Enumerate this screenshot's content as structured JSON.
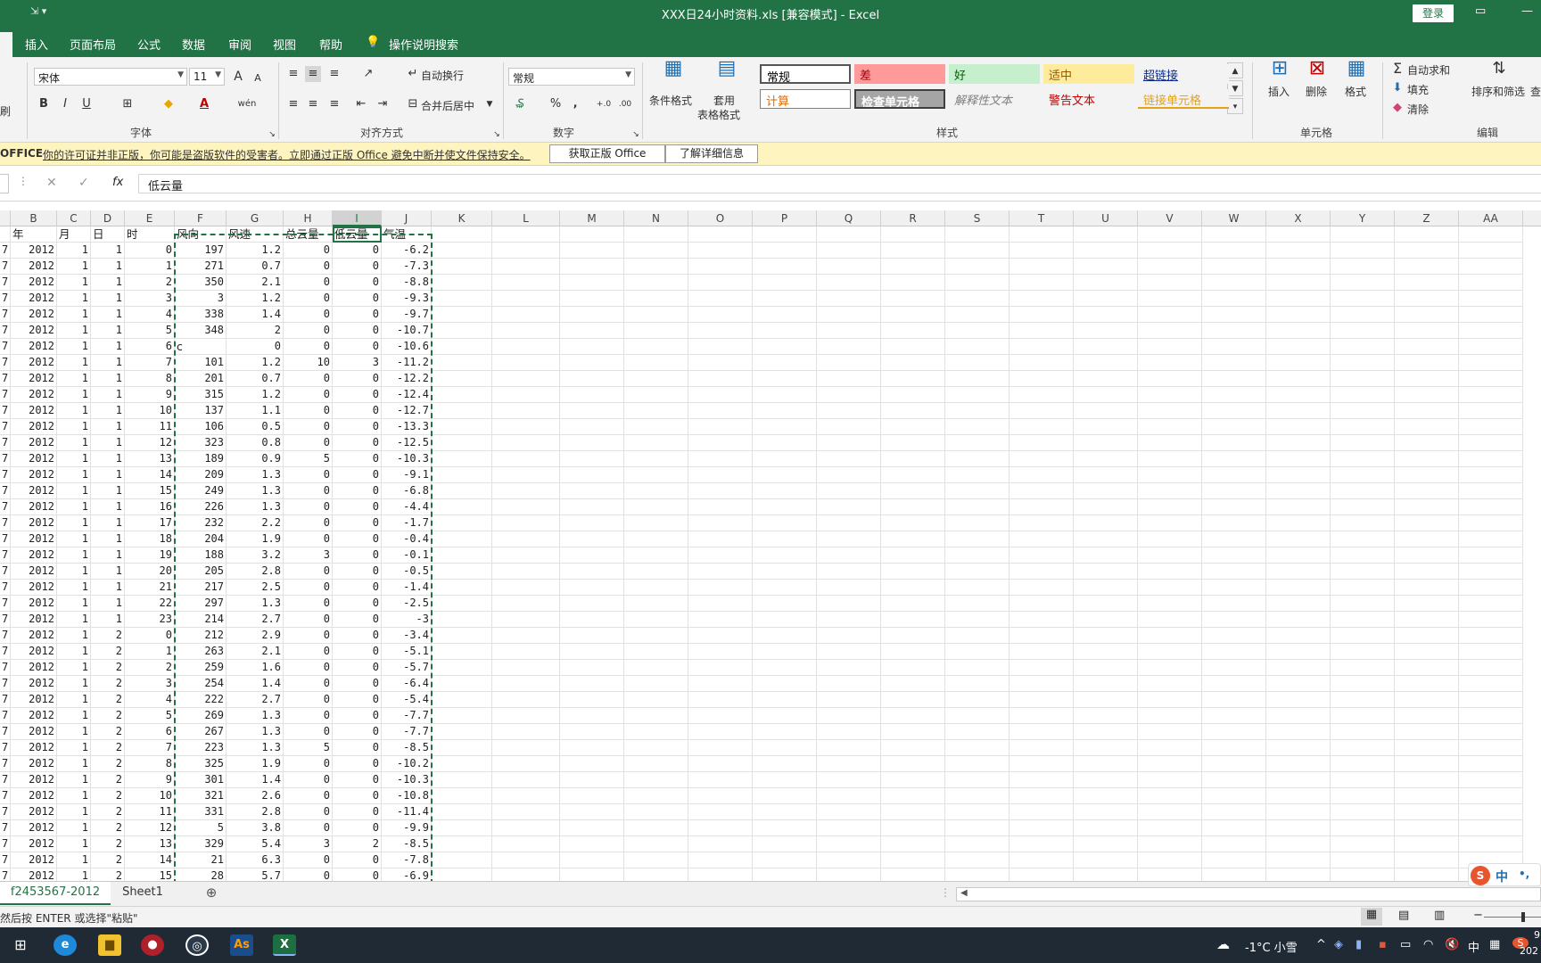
{
  "window": {
    "title": "XXX日24小时资料.xls  [兼容模式]  -  Excel",
    "login": "登录",
    "quick_access": "⇲  ▾"
  },
  "tabs": [
    "插入",
    "页面布局",
    "公式",
    "数据",
    "审阅",
    "视图",
    "帮助",
    "操作说明搜索"
  ],
  "ribbon": {
    "paste_fragment": "刷",
    "font": {
      "name": "宋体",
      "size": "11",
      "group": "字体",
      "grow": "A",
      "shrink": "A",
      "bold": "B",
      "italic": "I",
      "underline": "U",
      "wen": "wén"
    },
    "align": {
      "wrap": "自动换行",
      "merge": "合并后居中",
      "group": "对齐方式"
    },
    "number": {
      "format": "常规",
      "group": "数字",
      "percent": "%",
      "comma": "‚",
      "inc": "←.0\n.00",
      "dec": ".00\n→.0"
    },
    "styles": {
      "cond_format": "条件格式",
      "table_format_1": "套用",
      "table_format_2": "表格格式",
      "group": "样式",
      "items": [
        {
          "label": "常规",
          "bg": "#ffffff",
          "color": "#000000"
        },
        {
          "label": "差",
          "bg": "#ff9a9a",
          "color": "#9c0006"
        },
        {
          "label": "好",
          "bg": "#c6efce",
          "color": "#006100"
        },
        {
          "label": "适中",
          "bg": "#ffeb9c",
          "color": "#9c5700"
        },
        {
          "label": "超链接",
          "bg": "#f3f3f3",
          "color": "#0b2b8f"
        },
        {
          "label": "计算",
          "bg": "#ffffff",
          "color": "#e36c09"
        },
        {
          "label": "检查单元格",
          "bg": "#a5a5a5",
          "color": "#ffffff"
        },
        {
          "label": "解释性文本",
          "bg": "#f3f3f3",
          "color": "#7f7f7f"
        },
        {
          "label": "警告文本",
          "bg": "#f3f3f3",
          "color": "#c00000"
        },
        {
          "label": "链接单元格",
          "bg": "#f3f3f3",
          "color": "#e3a21a"
        }
      ]
    },
    "cells": {
      "insert": "插入",
      "delete": "删除",
      "format": "格式",
      "group": "单元格"
    },
    "edit": {
      "autosum": "自动求和",
      "fill": "填充",
      "clear": "清除",
      "sort": "排序和筛选",
      "find": "查",
      "group": "编辑"
    }
  },
  "message_bar": {
    "label": "OFFICE",
    "text": "你的许可证并非正版，你可能是盗版软件的受害者。立即通过正版 Office 避免中断并使文件保持安全。",
    "btn_get": "获取正版 Office",
    "btn_learn": "了解详细信息"
  },
  "formula_bar": {
    "content": "低云量",
    "fx": "fx",
    "cancel": "✕",
    "enter": "✓"
  },
  "columns": [
    "B",
    "C",
    "D",
    "E",
    "F",
    "G",
    "H",
    "I",
    "J",
    "K",
    "L",
    "M",
    "N",
    "O",
    "P",
    "Q",
    "R",
    "S",
    "T",
    "U",
    "V",
    "W",
    "X",
    "Y",
    "Z",
    "AA"
  ],
  "header_row": [
    "年",
    "月",
    "日",
    "时",
    "风向",
    "风速",
    "总云量",
    "低云量",
    "气温"
  ],
  "rows": [
    [
      "7",
      "2012",
      "1",
      "1",
      "0",
      "197",
      "1.2",
      "0",
      "0",
      "-6.2"
    ],
    [
      "7",
      "2012",
      "1",
      "1",
      "1",
      "271",
      "0.7",
      "0",
      "0",
      "-7.3"
    ],
    [
      "7",
      "2012",
      "1",
      "1",
      "2",
      "350",
      "2.1",
      "0",
      "0",
      "-8.8"
    ],
    [
      "7",
      "2012",
      "1",
      "1",
      "3",
      "3",
      "1.2",
      "0",
      "0",
      "-9.3"
    ],
    [
      "7",
      "2012",
      "1",
      "1",
      "4",
      "338",
      "1.4",
      "0",
      "0",
      "-9.7"
    ],
    [
      "7",
      "2012",
      "1",
      "1",
      "5",
      "348",
      "2",
      "0",
      "0",
      "-10.7"
    ],
    [
      "7",
      "2012",
      "1",
      "1",
      "6",
      "c",
      "0",
      "0",
      "0",
      "-10.6"
    ],
    [
      "7",
      "2012",
      "1",
      "1",
      "7",
      "101",
      "1.2",
      "10",
      "3",
      "-11.2"
    ],
    [
      "7",
      "2012",
      "1",
      "1",
      "8",
      "201",
      "0.7",
      "0",
      "0",
      "-12.2"
    ],
    [
      "7",
      "2012",
      "1",
      "1",
      "9",
      "315",
      "1.2",
      "0",
      "0",
      "-12.4"
    ],
    [
      "7",
      "2012",
      "1",
      "1",
      "10",
      "137",
      "1.1",
      "0",
      "0",
      "-12.7"
    ],
    [
      "7",
      "2012",
      "1",
      "1",
      "11",
      "106",
      "0.5",
      "0",
      "0",
      "-13.3"
    ],
    [
      "7",
      "2012",
      "1",
      "1",
      "12",
      "323",
      "0.8",
      "0",
      "0",
      "-12.5"
    ],
    [
      "7",
      "2012",
      "1",
      "1",
      "13",
      "189",
      "0.9",
      "5",
      "0",
      "-10.3"
    ],
    [
      "7",
      "2012",
      "1",
      "1",
      "14",
      "209",
      "1.3",
      "0",
      "0",
      "-9.1"
    ],
    [
      "7",
      "2012",
      "1",
      "1",
      "15",
      "249",
      "1.3",
      "0",
      "0",
      "-6.8"
    ],
    [
      "7",
      "2012",
      "1",
      "1",
      "16",
      "226",
      "1.3",
      "0",
      "0",
      "-4.4"
    ],
    [
      "7",
      "2012",
      "1",
      "1",
      "17",
      "232",
      "2.2",
      "0",
      "0",
      "-1.7"
    ],
    [
      "7",
      "2012",
      "1",
      "1",
      "18",
      "204",
      "1.9",
      "0",
      "0",
      "-0.4"
    ],
    [
      "7",
      "2012",
      "1",
      "1",
      "19",
      "188",
      "3.2",
      "3",
      "0",
      "-0.1"
    ],
    [
      "7",
      "2012",
      "1",
      "1",
      "20",
      "205",
      "2.8",
      "0",
      "0",
      "-0.5"
    ],
    [
      "7",
      "2012",
      "1",
      "1",
      "21",
      "217",
      "2.5",
      "0",
      "0",
      "-1.4"
    ],
    [
      "7",
      "2012",
      "1",
      "1",
      "22",
      "297",
      "1.3",
      "0",
      "0",
      "-2.5"
    ],
    [
      "7",
      "2012",
      "1",
      "1",
      "23",
      "214",
      "2.7",
      "0",
      "0",
      "-3"
    ],
    [
      "7",
      "2012",
      "1",
      "2",
      "0",
      "212",
      "2.9",
      "0",
      "0",
      "-3.4"
    ],
    [
      "7",
      "2012",
      "1",
      "2",
      "1",
      "263",
      "2.1",
      "0",
      "0",
      "-5.1"
    ],
    [
      "7",
      "2012",
      "1",
      "2",
      "2",
      "259",
      "1.6",
      "0",
      "0",
      "-5.7"
    ],
    [
      "7",
      "2012",
      "1",
      "2",
      "3",
      "254",
      "1.4",
      "0",
      "0",
      "-6.4"
    ],
    [
      "7",
      "2012",
      "1",
      "2",
      "4",
      "222",
      "2.7",
      "0",
      "0",
      "-5.4"
    ],
    [
      "7",
      "2012",
      "1",
      "2",
      "5",
      "269",
      "1.3",
      "0",
      "0",
      "-7.7"
    ],
    [
      "7",
      "2012",
      "1",
      "2",
      "6",
      "267",
      "1.3",
      "0",
      "0",
      "-7.7"
    ],
    [
      "7",
      "2012",
      "1",
      "2",
      "7",
      "223",
      "1.3",
      "5",
      "0",
      "-8.5"
    ],
    [
      "7",
      "2012",
      "1",
      "2",
      "8",
      "325",
      "1.9",
      "0",
      "0",
      "-10.2"
    ],
    [
      "7",
      "2012",
      "1",
      "2",
      "9",
      "301",
      "1.4",
      "0",
      "0",
      "-10.3"
    ],
    [
      "7",
      "2012",
      "1",
      "2",
      "10",
      "321",
      "2.6",
      "0",
      "0",
      "-10.8"
    ],
    [
      "7",
      "2012",
      "1",
      "2",
      "11",
      "331",
      "2.8",
      "0",
      "0",
      "-11.4"
    ],
    [
      "7",
      "2012",
      "1",
      "2",
      "12",
      "5",
      "3.8",
      "0",
      "0",
      "-9.9"
    ],
    [
      "7",
      "2012",
      "1",
      "2",
      "13",
      "329",
      "5.4",
      "3",
      "2",
      "-8.5"
    ],
    [
      "7",
      "2012",
      "1",
      "2",
      "14",
      "21",
      "6.3",
      "0",
      "0",
      "-7.8"
    ],
    [
      "7",
      "2012",
      "1",
      "2",
      "15",
      "28",
      "5.7",
      "0",
      "0",
      "-6.9"
    ]
  ],
  "sheets": [
    "f2453567-2012",
    "Sheet1"
  ],
  "status": {
    "text": "然后按 ENTER 或选择\"粘贴\""
  },
  "ime": {
    "lang": "中",
    "punct": "•,"
  },
  "taskbar": {
    "weather": "-1°C 小雪",
    "ime": "中",
    "date_fragment": "202",
    "time_fragment": "9",
    "icon_speaker": "🔇"
  },
  "accent_color": "#217346"
}
